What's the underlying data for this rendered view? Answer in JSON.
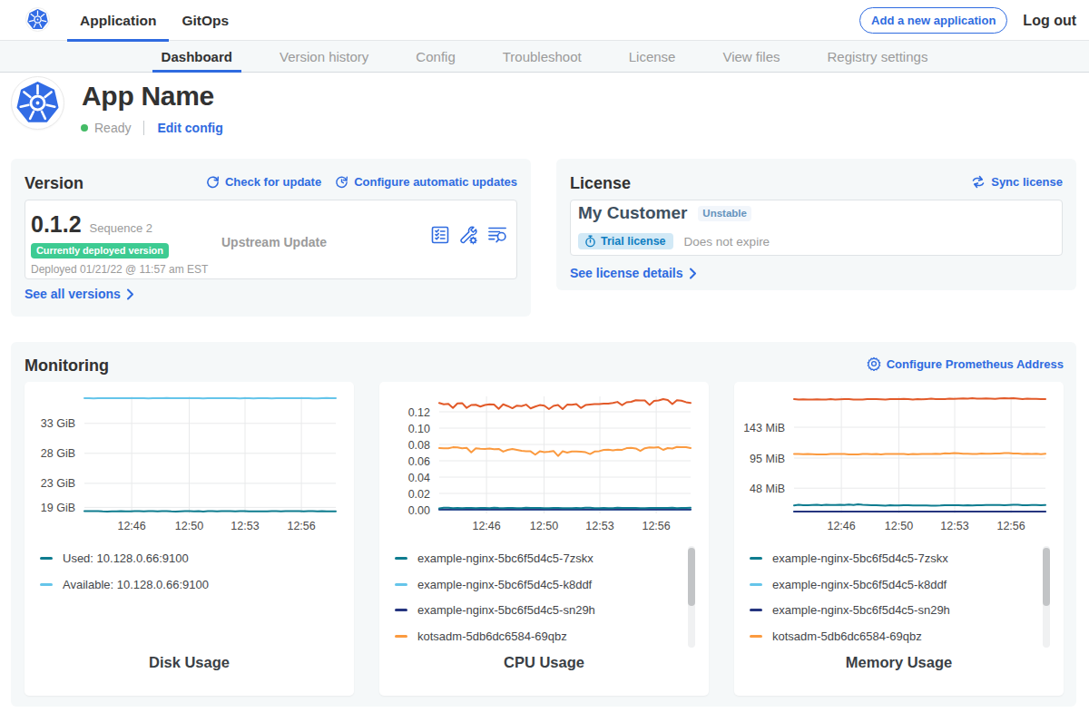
{
  "colors": {
    "link_blue": "#2f6be0",
    "k8s_blue": "#326ce5",
    "green_badge": "#3dcb92",
    "ready_green": "#44bb66",
    "teal": "#0e7c8f",
    "light_blue": "#65c5ea",
    "navy": "#25357f",
    "orange": "#fb9a3f",
    "red_orange": "#e25a29"
  },
  "nav": {
    "tabs": [
      {
        "label": "Application",
        "active": true
      },
      {
        "label": "GitOps",
        "active": false
      }
    ],
    "add_app_button": "Add a new application",
    "logout": "Log out"
  },
  "subnav": {
    "items": [
      {
        "label": "Dashboard",
        "active": true
      },
      {
        "label": "Version history",
        "active": false
      },
      {
        "label": "Config",
        "active": false
      },
      {
        "label": "Troubleshoot",
        "active": false
      },
      {
        "label": "License",
        "active": false
      },
      {
        "label": "View files",
        "active": false
      },
      {
        "label": "Registry settings",
        "active": false
      }
    ]
  },
  "app_header": {
    "name": "App Name",
    "status": "Ready",
    "edit_config": "Edit config"
  },
  "version_card": {
    "title": "Version",
    "check_update": "Check for update",
    "configure_updates": "Configure automatic updates",
    "version_number": "0.1.2",
    "sequence": "Sequence 2",
    "deployed_badge": "Currently deployed version",
    "deployed_at": "Deployed 01/21/22 @ 11:57 am EST",
    "upstream": "Upstream Update",
    "see_all": "See all versions"
  },
  "license_card": {
    "title": "License",
    "sync": "Sync license",
    "customer": "My Customer",
    "channel": "Unstable",
    "trial_badge": "Trial license",
    "expiry": "Does not expire",
    "see_details": "See license details"
  },
  "monitoring": {
    "title": "Monitoring",
    "configure": "Configure Prometheus Address"
  },
  "chart_data": [
    {
      "type": "line",
      "title": "Disk Usage",
      "ylim": [
        18.15,
        37.5
      ],
      "y_ticks": [
        {
          "value": 33,
          "label": "33 GiB"
        },
        {
          "value": 28,
          "label": "28 GiB"
        },
        {
          "value": 23,
          "label": "23 GiB"
        },
        {
          "value": 19,
          "label": "19 GiB"
        }
      ],
      "x_ticks": [
        {
          "frac": 0.188,
          "label": "12:46"
        },
        {
          "frac": 0.417,
          "label": "12:50"
        },
        {
          "frac": 0.639,
          "label": "12:53"
        },
        {
          "frac": 0.863,
          "label": "12:56"
        }
      ],
      "series": [
        {
          "name": "Used: 10.128.0.66:9100",
          "color": "#0e7c8f",
          "values": [
            18.37,
            18.36,
            18.37,
            18.38,
            18.33,
            18.32,
            18.33,
            18.33,
            18.36,
            18.35,
            18.33,
            18.36,
            18.37,
            18.33,
            18.36,
            18.36,
            18.33,
            18.37,
            18.38,
            18.33,
            18.32,
            18.34,
            18.36,
            18.38,
            18.34,
            18.36,
            18.32,
            18.36,
            18.36,
            18.33,
            18.37,
            18.37,
            18.36,
            18.33,
            18.38,
            18.37,
            18.34,
            18.35,
            18.34,
            18.35,
            18.34,
            18.37,
            18.37,
            18.33,
            18.38,
            18.36,
            18.37,
            18.36,
            18.35,
            18.36,
            18.38,
            18.34,
            18.37,
            18.35,
            18.35,
            18.35
          ]
        },
        {
          "name": "Available: 10.128.0.66:9100",
          "color": "#65c5ea",
          "values": [
            37.21,
            37.21,
            37.17,
            37.19,
            37.2,
            37.19,
            37.18,
            37.2,
            37.22,
            37.21,
            37.21,
            37.22,
            37.22,
            37.19,
            37.17,
            37.19,
            37.22,
            37.22,
            37.23,
            37.2,
            37.21,
            37.2,
            37.21,
            37.18,
            37.18,
            37.2,
            37.17,
            37.19,
            37.21,
            37.19,
            37.18,
            37.2,
            37.18,
            37.21,
            37.17,
            37.19,
            37.2,
            37.17,
            37.21,
            37.18,
            37.2,
            37.17,
            37.19,
            37.18,
            37.19,
            37.22,
            37.19,
            37.22,
            37.22,
            37.19,
            37.17,
            37.17,
            37.2,
            37.23,
            37.19,
            37.21
          ]
        }
      ],
      "legend": [
        {
          "label": "Used: 10.128.0.66:9100",
          "color": "#0e7c8f"
        },
        {
          "label": "Available: 10.128.0.66:9100",
          "color": "#65c5ea"
        }
      ],
      "legend_scrollbar": false
    },
    {
      "type": "line",
      "title": "CPU Usage",
      "ylim": [
        -0.0033,
        0.1389
      ],
      "y_ticks": [
        {
          "value": 0.12,
          "label": "0.12"
        },
        {
          "value": 0.1,
          "label": "0.10"
        },
        {
          "value": 0.08,
          "label": "0.08"
        },
        {
          "value": 0.06,
          "label": "0.06"
        },
        {
          "value": 0.04,
          "label": "0.04"
        },
        {
          "value": 0.02,
          "label": "0.02"
        },
        {
          "value": 0.0,
          "label": "0.00"
        }
      ],
      "x_ticks": [
        {
          "frac": 0.188,
          "label": "12:46"
        },
        {
          "frac": 0.417,
          "label": "12:50"
        },
        {
          "frac": 0.639,
          "label": "12:53"
        },
        {
          "frac": 0.863,
          "label": "12:56"
        }
      ],
      "series": [
        {
          "name": "example-nginx-5bc6f5d4c5-k8ddf",
          "color": "#65c5ea",
          "values": [
            0.0002,
            0.0002,
            0.0003,
            0.0003,
            0.0003,
            0.0002,
            0.0004,
            0.0003,
            0.0004,
            0.0003,
            0.0002,
            0.0004,
            0.0004,
            0.0004,
            0.0004,
            0.0004,
            0.0002,
            0.0003,
            0.0002,
            0.0003,
            0.0002,
            0.0003,
            0.0004,
            0.0003,
            0.0004,
            0.0003,
            0.0003,
            0.0004,
            0.0004,
            0.0003,
            0.0003,
            0.0002,
            0.0003,
            0.0004,
            0.0003,
            0.0003,
            0.0003,
            0.0002,
            0.0003,
            0.0003,
            0.0004,
            0.0002,
            0.0004,
            0.0002,
            0.0002,
            0.0003,
            0.0003,
            0.0002,
            0.0002,
            0.0004,
            0.0002,
            0.0003,
            0.0003,
            0.0003,
            0.0003,
            0.0003
          ]
        },
        {
          "name": "example-nginx-5bc6f5d4c5-sn29h",
          "color": "#25357f",
          "values": [
            0.0002,
            0.0002,
            0.0003,
            0.0003,
            0.0003,
            0.0002,
            0.0004,
            0.0003,
            0.0004,
            0.0003,
            0.0002,
            0.0004,
            0.0004,
            0.0004,
            0.0004,
            0.0004,
            0.0002,
            0.0003,
            0.0002,
            0.0003,
            0.0002,
            0.0003,
            0.0004,
            0.0003,
            0.0004,
            0.0003,
            0.0003,
            0.0004,
            0.0004,
            0.0003,
            0.0003,
            0.0002,
            0.0003,
            0.0004,
            0.0003,
            0.0003,
            0.0003,
            0.0002,
            0.0003,
            0.0003,
            0.0004,
            0.0002,
            0.0004,
            0.0002,
            0.0002,
            0.0003,
            0.0003,
            0.0002,
            0.0002,
            0.0004,
            0.0002,
            0.0003,
            0.0003,
            0.0003,
            0.0003,
            0.0003
          ]
        },
        {
          "name": "example-nginx-5bc6f5d4c5-7zskx",
          "color": "#0e7c8f",
          "values": [
            0.0018,
            0.0025,
            0.0026,
            0.0019,
            0.0022,
            0.0019,
            0.0024,
            0.0024,
            0.0019,
            0.0022,
            0.0022,
            0.002,
            0.0025,
            0.0021,
            0.002,
            0.0022,
            0.0024,
            0.002,
            0.002,
            0.0026,
            0.0023,
            0.0022,
            0.0022,
            0.0019,
            0.002,
            0.0021,
            0.0023,
            0.002,
            0.002,
            0.0019,
            0.0023,
            0.002,
            0.0025,
            0.0025,
            0.0019,
            0.002,
            0.0023,
            0.002,
            0.0019,
            0.0025,
            0.0023,
            0.0022,
            0.0024,
            0.0024,
            0.002,
            0.0019,
            0.0021,
            0.0021,
            0.0022,
            0.0024,
            0.0023,
            0.0026,
            0.0019,
            0.0021,
            0.0021,
            0.0025
          ]
        },
        {
          "name": "kotsadm-5db6dc6584-69qbz",
          "color": "#fb9a3f",
          "values": [
            0.0756,
            0.0754,
            0.0752,
            0.0766,
            0.0764,
            0.0752,
            0.0758,
            0.0702,
            0.0752,
            0.0747,
            0.0746,
            0.0751,
            0.0742,
            0.0746,
            0.0712,
            0.0733,
            0.0745,
            0.0733,
            0.0721,
            0.0718,
            0.0716,
            0.0676,
            0.0716,
            0.0706,
            0.071,
            0.072,
            0.0659,
            0.0717,
            0.07,
            0.0714,
            0.0714,
            0.0711,
            0.0705,
            0.0682,
            0.0713,
            0.0718,
            0.0733,
            0.0736,
            0.0728,
            0.0737,
            0.0735,
            0.0755,
            0.0758,
            0.0751,
            0.072,
            0.0753,
            0.0765,
            0.0761,
            0.0766,
            0.0733,
            0.0756,
            0.075,
            0.0769,
            0.0768,
            0.0767,
            0.0756
          ]
        },
        {
          "name": "",
          "color": "#e25a29",
          "values": [
            0.1308,
            0.1292,
            0.1297,
            0.1248,
            0.1303,
            0.1307,
            0.1248,
            0.1283,
            0.1286,
            0.1263,
            0.1283,
            0.1292,
            0.1288,
            0.1236,
            0.1291,
            0.127,
            0.1243,
            0.1276,
            0.127,
            0.1288,
            0.1242,
            0.1265,
            0.1282,
            0.1275,
            0.1233,
            0.1272,
            0.1285,
            0.1233,
            0.1288,
            0.1286,
            0.1296,
            0.1247,
            0.1282,
            0.129,
            0.1295,
            0.1293,
            0.13,
            0.1301,
            0.1308,
            0.1321,
            0.1281,
            0.1317,
            0.1322,
            0.1342,
            0.1339,
            0.1339,
            0.1285,
            0.1332,
            0.1339,
            0.1356,
            0.1346,
            0.1295,
            0.1342,
            0.1336,
            0.1318,
            0.1309
          ]
        }
      ],
      "legend": [
        {
          "label": "example-nginx-5bc6f5d4c5-7zskx",
          "color": "#0e7c8f"
        },
        {
          "label": "example-nginx-5bc6f5d4c5-k8ddf",
          "color": "#65c5ea"
        },
        {
          "label": "example-nginx-5bc6f5d4c5-sn29h",
          "color": "#25357f"
        },
        {
          "label": "kotsadm-5db6dc6584-69qbz",
          "color": "#fb9a3f"
        }
      ],
      "legend_scrollbar": true
    },
    {
      "type": "line",
      "title": "Memory Usage",
      "ylim": [
        10.0,
        191.2
      ],
      "y_ticks": [
        {
          "value": 143,
          "label": "143 MiB"
        },
        {
          "value": 95,
          "label": "95 MiB"
        },
        {
          "value": 48,
          "label": "48 MiB"
        }
      ],
      "x_ticks": [
        {
          "frac": 0.188,
          "label": "12:46"
        },
        {
          "frac": 0.417,
          "label": "12:50"
        },
        {
          "frac": 0.639,
          "label": "12:53"
        },
        {
          "frac": 0.863,
          "label": "12:56"
        }
      ],
      "series": [
        {
          "name": "example-nginx-5bc6f5d4c5-k8ddf",
          "color": "#65c5ea",
          "values": [
            11.5,
            11.4,
            11.3,
            11.3,
            11.3,
            11.3,
            11.4,
            11.5,
            11.3,
            11.4,
            11.4,
            11.3,
            11.4,
            11.4,
            11.3,
            11.4,
            11.3,
            11.5,
            11.5,
            11.3,
            11.4,
            11.3,
            11.5,
            11.4,
            11.3,
            11.3,
            11.5,
            11.4,
            11.5,
            11.4,
            11.5,
            11.4,
            11.5,
            11.5,
            11.4,
            11.4,
            11.4,
            11.5,
            11.4,
            11.5,
            11.4,
            11.4,
            11.4,
            11.3,
            11.4,
            11.5,
            11.4,
            11.4,
            11.4,
            11.3,
            11.4,
            11.4,
            11.4,
            11.4,
            11.3,
            11.3
          ]
        },
        {
          "name": "example-nginx-5bc6f5d4c5-sn29h",
          "color": "#25357f",
          "values": [
            11.5,
            11.4,
            11.3,
            11.3,
            11.3,
            11.3,
            11.4,
            11.5,
            11.3,
            11.4,
            11.4,
            11.3,
            11.4,
            11.4,
            11.3,
            11.4,
            11.3,
            11.5,
            11.5,
            11.3,
            11.4,
            11.3,
            11.5,
            11.4,
            11.3,
            11.3,
            11.5,
            11.4,
            11.5,
            11.4,
            11.5,
            11.4,
            11.5,
            11.5,
            11.4,
            11.4,
            11.4,
            11.5,
            11.4,
            11.5,
            11.4,
            11.4,
            11.4,
            11.3,
            11.4,
            11.5,
            11.4,
            11.4,
            11.4,
            11.3,
            11.4,
            11.4,
            11.4,
            11.4,
            11.3,
            11.3
          ]
        },
        {
          "name": "example-nginx-5bc6f5d4c5-7zskx",
          "color": "#0e7c8f",
          "values": [
            21.1,
            21.9,
            21.3,
            21.2,
            21.6,
            21.9,
            21.5,
            21.9,
            21.8,
            21.8,
            22.0,
            21.7,
            22.3,
            21.6,
            22.6,
            22.1,
            21.7,
            21.4,
            21.4,
            21.0,
            20.7,
            21.3,
            21.0,
            20.9,
            21.5,
            21.3,
            20.9,
            20.9,
            21.0,
            21.0,
            20.8,
            20.7,
            20.9,
            21.5,
            21.2,
            21.5,
            21.3,
            21.0,
            21.4,
            20.9,
            21.3,
            21.5,
            21.7,
            21.8,
            21.7,
            21.7,
            21.5,
            21.8,
            22.2,
            22.2,
            21.5,
            21.3,
            21.6,
            21.7,
            21.2,
            21.6
          ]
        },
        {
          "name": "kotsadm-5db6dc6584-69qbz",
          "color": "#fb9a3f",
          "values": [
            101.1,
            101.1,
            100.9,
            101.1,
            100.9,
            100.6,
            100.6,
            100.7,
            101.2,
            101.1,
            101.2,
            101.2,
            100.7,
            100.7,
            100.6,
            101.2,
            101.3,
            100.9,
            101.1,
            100.7,
            101.3,
            101.3,
            101.4,
            101.3,
            101.3,
            100.7,
            101.2,
            100.9,
            101.4,
            101.3,
            101.4,
            101.6,
            101.5,
            102.3,
            102.1,
            102.8,
            102.5,
            101.6,
            101.8,
            101.4,
            101.4,
            102.0,
            101.6,
            101.6,
            101.9,
            102.1,
            102.7,
            102.8,
            101.9,
            101.9,
            101.3,
            101.6,
            101.3,
            101.7,
            101.0,
            101.8
          ]
        },
        {
          "name": "",
          "color": "#e25a29",
          "values": [
            186.9,
            186.2,
            186.7,
            186.3,
            186.4,
            186.7,
            186.4,
            186.4,
            186.8,
            186.2,
            186.6,
            187.1,
            187.1,
            186.2,
            186.4,
            186.4,
            187.1,
            187.1,
            187.1,
            186.6,
            186.4,
            187.1,
            186.9,
            186.9,
            187.2,
            186.9,
            186.3,
            187.1,
            186.7,
            187.1,
            187.5,
            186.8,
            186.9,
            187.0,
            187.6,
            187.4,
            187.8,
            188.0,
            187.6,
            188.2,
            187.8,
            187.7,
            187.9,
            187.6,
            187.2,
            187.9,
            188.2,
            188.1,
            188.3,
            187.7,
            187.1,
            187.6,
            187.4,
            187.4,
            187.0,
            187.1
          ]
        }
      ],
      "legend": [
        {
          "label": "example-nginx-5bc6f5d4c5-7zskx",
          "color": "#0e7c8f"
        },
        {
          "label": "example-nginx-5bc6f5d4c5-k8ddf",
          "color": "#65c5ea"
        },
        {
          "label": "example-nginx-5bc6f5d4c5-sn29h",
          "color": "#25357f"
        },
        {
          "label": "kotsadm-5db6dc6584-69qbz",
          "color": "#fb9a3f"
        }
      ],
      "legend_scrollbar": true
    }
  ]
}
